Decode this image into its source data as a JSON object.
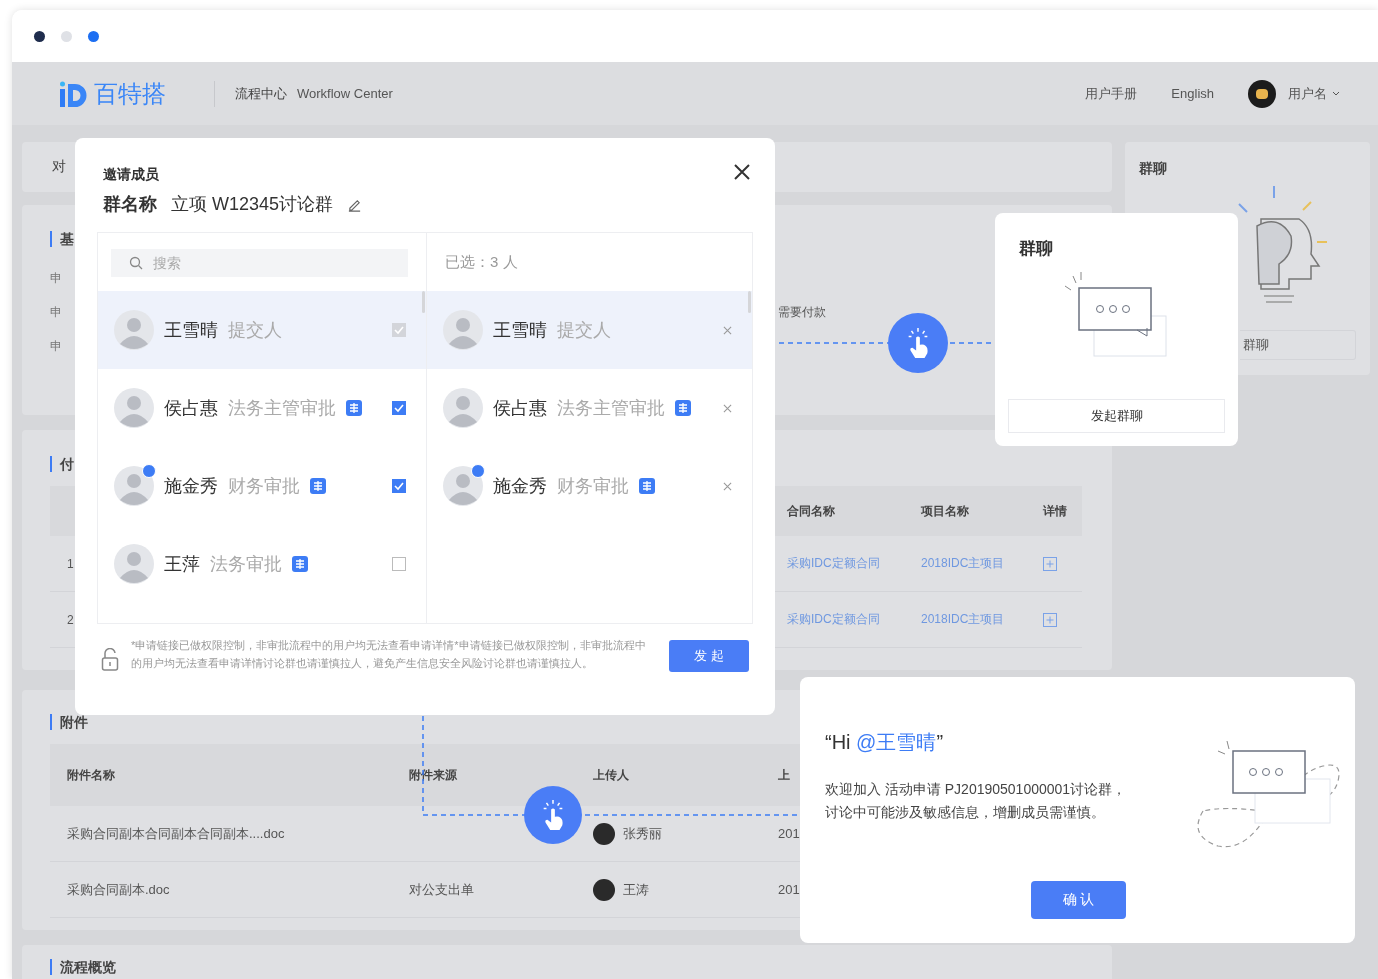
{
  "browser": {
    "controls": [
      {
        "color": "#1f2d4d"
      },
      {
        "color": "#dfe1e6"
      },
      {
        "color": "#1d6ff2"
      }
    ]
  },
  "header": {
    "brand": "百特搭",
    "product_cn": "流程中心",
    "product_en": "Workflow Center",
    "links": [
      "用户手册",
      "English"
    ],
    "user": "用户名"
  },
  "page": {
    "top_panel": {
      "label": "对"
    },
    "basic_section": {
      "title": "基",
      "rows": [
        {
          "label": "申"
        },
        {
          "label": "申",
          "column_2": "需要付款"
        },
        {
          "label": "申"
        }
      ]
    },
    "payment_section": {
      "title": "付",
      "columns": [
        "合同名称",
        "项目名称",
        "详情"
      ],
      "rows": [
        {
          "index": "1",
          "contract": "采购IDC定额合同",
          "project": "2018IDC主项目"
        },
        {
          "index": "2",
          "contract": "采购IDC定额合同",
          "project": "2018IDC主项目"
        }
      ]
    },
    "attachments": {
      "title": "附件",
      "columns": [
        "附件名称",
        "附件来源",
        "上传人",
        "上"
      ],
      "rows": [
        {
          "name": "采购合同副本合同副本合同副本....doc",
          "uploader": "张秀丽",
          "column_4": "201"
        },
        {
          "name": "采购合同副本.doc",
          "source": "对公支出单",
          "uploader": "王涛",
          "column_4": "201"
        }
      ]
    },
    "overview": {
      "title": "流程概览"
    },
    "side_panel": {
      "title": "群聊",
      "button": "群聊"
    }
  },
  "invite_dialog": {
    "title": "邀请成员",
    "group_label": "群名称",
    "group_name": "立项 W12345讨论群",
    "search": {
      "placeholder": "搜索"
    },
    "members": [
      {
        "name": "王雪晴",
        "role": "提交人",
        "badge": false,
        "avatar_badge": false,
        "checked": true,
        "disabled": true,
        "hovered": true
      },
      {
        "name": "侯占惠",
        "role": "法务主管审批",
        "badge": true,
        "avatar_badge": false,
        "checked": true,
        "disabled": false,
        "hovered": false
      },
      {
        "name": "施金秀",
        "role": "财务审批",
        "badge": true,
        "avatar_badge": true,
        "checked": true,
        "disabled": false,
        "hovered": false
      },
      {
        "name": "王萍",
        "role": "法务审批",
        "badge": true,
        "avatar_badge": false,
        "checked": false,
        "disabled": false,
        "hovered": false
      }
    ],
    "selected_count": "已选：3 人",
    "selected_members": [
      {
        "name": "王雪晴",
        "role": "提交人",
        "badge": false,
        "avatar_badge": false,
        "hovered": true
      },
      {
        "name": "侯占惠",
        "role": "法务主管审批",
        "badge": true,
        "avatar_badge": false,
        "hovered": false
      },
      {
        "name": "施金秀",
        "role": "财务审批",
        "badge": true,
        "avatar_badge": true,
        "hovered": false
      }
    ],
    "notice": "*申请链接已做权限控制，非审批流程中的用户均无法查看申请详情*申请链接已做权限控制，非审批流程中的用户均无法查看申请详情讨论群也请谨慎拉人，避免产生信息安全风险讨论群也请谨慎拉人。",
    "submit": "发 起"
  },
  "group_chat_card": {
    "title": "群聊",
    "button": "发起群聊"
  },
  "welcome_card": {
    "greeting": "“Hi ",
    "mention": "@王雪晴",
    "closing": "”",
    "message_lines": [
      "欢迎加入 活动申请 PJ20190501000001讨论群，",
      "讨论中可能涉及敏感信息，增删成员需谨慎。"
    ],
    "confirm": "确 认"
  }
}
